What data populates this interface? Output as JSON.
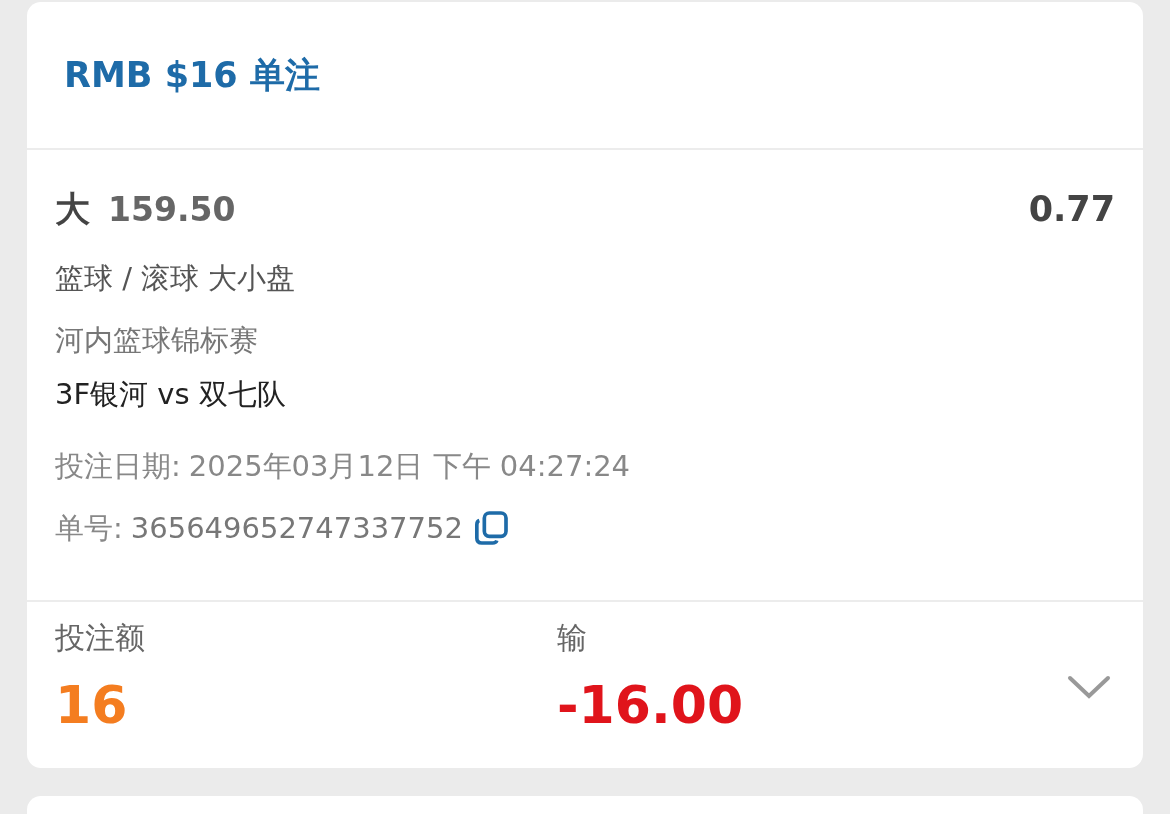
{
  "header": {
    "title": "RMB $16 单注"
  },
  "bet": {
    "selection": "大",
    "line": "159.50",
    "odds": "0.77",
    "market": "篮球 / 滚球 大小盘",
    "league": "河内篮球锦标赛",
    "match": "3F银河 vs 双七队",
    "date_label": "投注日期:",
    "date": "2025年03月12日 下午 04:27:24",
    "ticket_label": "单号:",
    "ticket_no": "365649652747337752"
  },
  "footer": {
    "stake_label": "投注额",
    "stake": "16",
    "result_label": "输",
    "result": "-16.00",
    "expanded": false
  }
}
